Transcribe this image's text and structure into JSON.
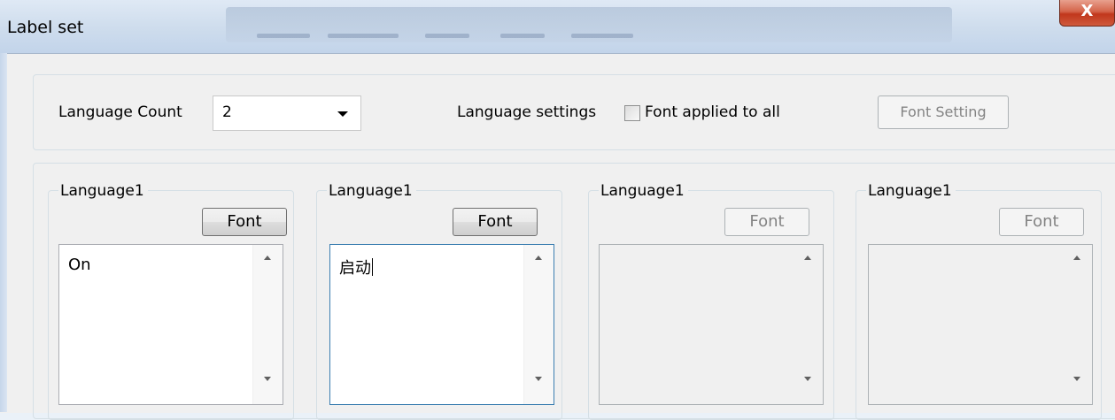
{
  "window": {
    "title": "Label set",
    "close_label": "X"
  },
  "top_group": {
    "language_count_label": "Language Count",
    "language_count_value": "2",
    "language_settings_label": "Language settings",
    "font_applied_to_all_label": "Font applied to all",
    "font_applied_to_all_checked": false,
    "font_setting_button": "Font Setting",
    "font_setting_enabled": false
  },
  "languages": [
    {
      "title": "Language1",
      "font_button": "Font",
      "enabled": true,
      "text": "On"
    },
    {
      "title": "Language1",
      "font_button": "Font",
      "enabled": true,
      "text": "启动"
    },
    {
      "title": "Language1",
      "font_button": "Font",
      "enabled": false,
      "text": ""
    },
    {
      "title": "Language1",
      "font_button": "Font",
      "enabled": false,
      "text": ""
    }
  ],
  "colors": {
    "dialog_bg": "#f0f0f0",
    "close_button": "#c1371c",
    "focus_border": "#3c7fb1",
    "disabled_text": "#838383"
  }
}
